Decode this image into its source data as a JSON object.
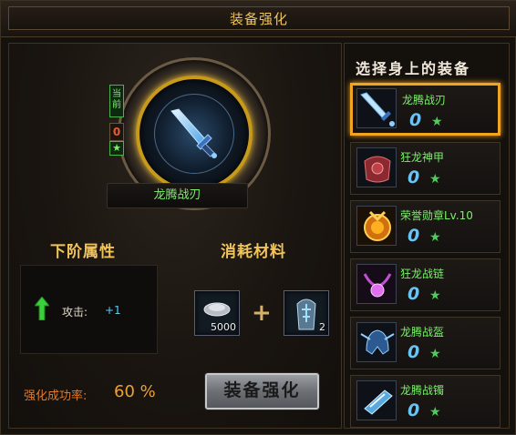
{
  "window": {
    "title": "装备强化"
  },
  "current_item": {
    "badge_current": "当前",
    "level": "0",
    "star": "★",
    "name": "龙腾战刃"
  },
  "next_attributes": {
    "title": "下阶属性",
    "attr_label": "攻击:",
    "attr_value": "+1"
  },
  "materials": {
    "title": "消耗材料",
    "plus": "+",
    "items": [
      {
        "count": "5000",
        "icon": "silver-ore-icon"
      },
      {
        "count": "2",
        "icon": "rune-stone-icon"
      }
    ]
  },
  "success_rate": {
    "label": "强化成功率:",
    "value": "60 %"
  },
  "enhance_button": {
    "label": "装备强化"
  },
  "equipment_list": {
    "title": "选择身上的装备",
    "items": [
      {
        "name": "龙腾战刃",
        "level": "0",
        "star": "★",
        "icon": "sword-icon",
        "selected": true
      },
      {
        "name": "狂龙神甲",
        "level": "0",
        "star": "★",
        "icon": "armor-icon",
        "selected": false
      },
      {
        "name": "荣誉勋章Lv.10",
        "level": "0",
        "star": "★",
        "icon": "medal-icon",
        "selected": false
      },
      {
        "name": "狂龙战链",
        "level": "0",
        "star": "★",
        "icon": "necklace-icon",
        "selected": false
      },
      {
        "name": "龙腾战盔",
        "level": "0",
        "star": "★",
        "icon": "helmet-icon",
        "selected": false
      },
      {
        "name": "龙腾战镯",
        "level": "0",
        "star": "★",
        "icon": "bracelet-icon",
        "selected": false
      }
    ]
  },
  "colors": {
    "title_gold": "#efc45a",
    "item_name_green": "#7bf06a",
    "level_blue": "#6ac3f5",
    "selected_border": "#f0a420",
    "rate_orange": "#e07a2a"
  }
}
